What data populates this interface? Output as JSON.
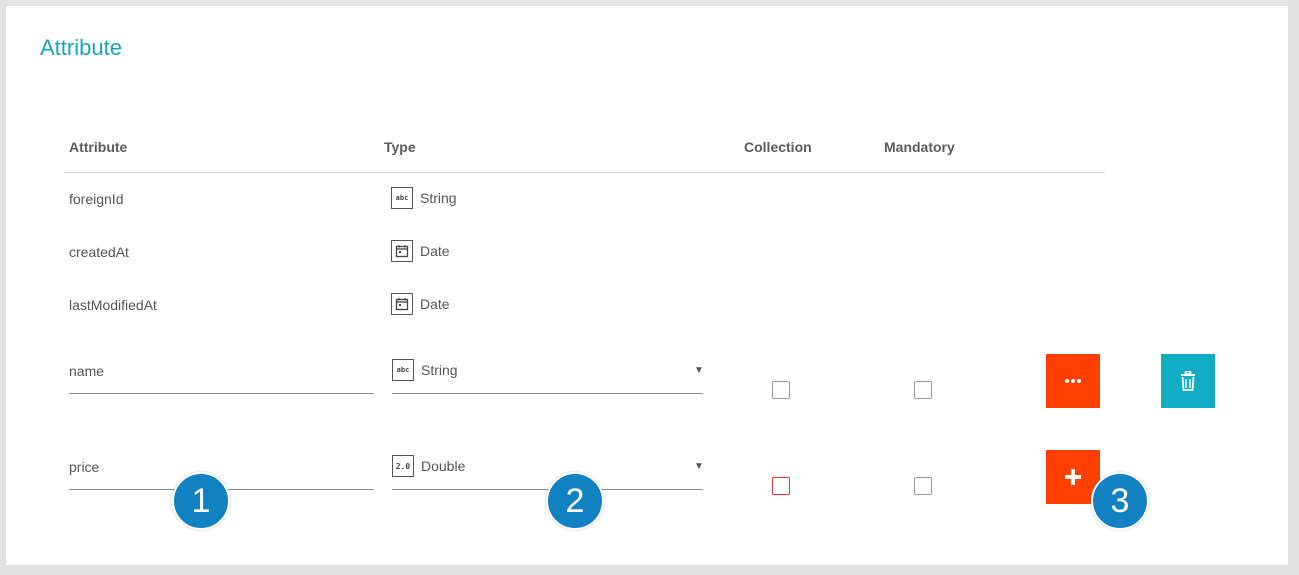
{
  "section_title": "Attribute",
  "columns": {
    "attribute": "Attribute",
    "type": "Type",
    "collection": "Collection",
    "mandatory": "Mandatory"
  },
  "readonly_rows": [
    {
      "name": "foreignId",
      "type": "String",
      "type_icon": "abc"
    },
    {
      "name": "createdAt",
      "type": "Date",
      "type_icon": "calendar-icon"
    },
    {
      "name": "lastModifiedAt",
      "type": "Date",
      "type_icon": "calendar-icon"
    }
  ],
  "edit_rows": [
    {
      "name": "name",
      "type": "String",
      "type_icon": "abc",
      "collection_checked": false,
      "mandatory_checked": false
    },
    {
      "name": "price",
      "type": "Double",
      "type_icon": "2.0",
      "collection_checked": false,
      "mandatory_checked": false
    }
  ],
  "buttons": {
    "more_icon": "more-horizontal-icon",
    "delete_icon": "trash-icon",
    "add_icon": "plus-icon"
  },
  "markers": [
    "1",
    "2",
    "3"
  ],
  "colors": {
    "title": "#19a2c1",
    "accent_orange": "#ff4000",
    "accent_teal": "#11adc4",
    "marker_blue": "#1281c2",
    "error_red": "#e0342f"
  }
}
